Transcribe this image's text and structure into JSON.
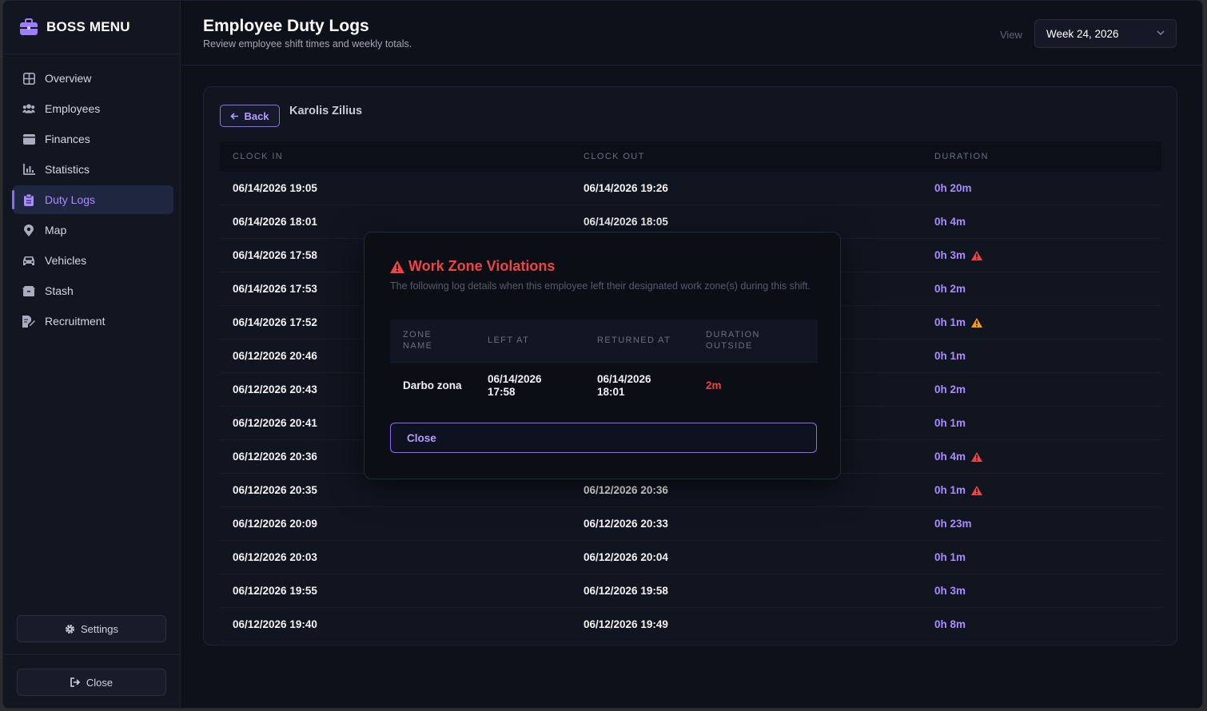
{
  "sidebar": {
    "brand": "BOSS MENU",
    "items": [
      {
        "label": "Overview",
        "icon": "grid-icon"
      },
      {
        "label": "Employees",
        "icon": "users-icon"
      },
      {
        "label": "Finances",
        "icon": "wallet-icon"
      },
      {
        "label": "Statistics",
        "icon": "chart-icon"
      },
      {
        "label": "Duty Logs",
        "icon": "clipboard-icon",
        "active": true
      },
      {
        "label": "Map",
        "icon": "map-pin-icon"
      },
      {
        "label": "Vehicles",
        "icon": "car-icon"
      },
      {
        "label": "Stash",
        "icon": "box-icon"
      },
      {
        "label": "Recruitment",
        "icon": "file-signature-icon"
      }
    ],
    "settings_label": "Settings",
    "close_label": "Close"
  },
  "header": {
    "title": "Employee Duty Logs",
    "subtitle": "Review employee shift times and weekly totals.",
    "view_label": "View",
    "week_value": "Week 24, 2026"
  },
  "card": {
    "back_label": "Back",
    "employee_name": "Karolis Zilius",
    "columns": [
      "CLOCK IN",
      "CLOCK OUT",
      "DURATION"
    ],
    "rows": [
      {
        "clock_in": "06/14/2026 19:05",
        "clock_out": "06/14/2026 19:26",
        "duration": "0h 20m",
        "warning": null
      },
      {
        "clock_in": "06/14/2026 18:01",
        "clock_out": "06/14/2026 18:05",
        "duration": "0h 4m",
        "warning": null
      },
      {
        "clock_in": "06/14/2026 17:58",
        "clock_out": "",
        "duration": "0h 3m",
        "warning": "red"
      },
      {
        "clock_in": "06/14/2026 17:53",
        "clock_out": "",
        "duration": "0h 2m",
        "warning": null
      },
      {
        "clock_in": "06/14/2026 17:52",
        "clock_out": "",
        "duration": "0h 1m",
        "warning": "orange"
      },
      {
        "clock_in": "06/12/2026 20:46",
        "clock_out": "",
        "duration": "0h 1m",
        "warning": null
      },
      {
        "clock_in": "06/12/2026 20:43",
        "clock_out": "",
        "duration": "0h 2m",
        "warning": null
      },
      {
        "clock_in": "06/12/2026 20:41",
        "clock_out": "",
        "duration": "0h 1m",
        "warning": null
      },
      {
        "clock_in": "06/12/2026 20:36",
        "clock_out": "",
        "duration": "0h 4m",
        "warning": "red"
      },
      {
        "clock_in": "06/12/2026 20:35",
        "clock_out": "06/12/2026 20:36",
        "duration": "0h 1m",
        "warning": "red"
      },
      {
        "clock_in": "06/12/2026 20:09",
        "clock_out": "06/12/2026 20:33",
        "duration": "0h 23m",
        "warning": null
      },
      {
        "clock_in": "06/12/2026 20:03",
        "clock_out": "06/12/2026 20:04",
        "duration": "0h 1m",
        "warning": null
      },
      {
        "clock_in": "06/12/2026 19:55",
        "clock_out": "06/12/2026 19:58",
        "duration": "0h 3m",
        "warning": null
      },
      {
        "clock_in": "06/12/2026 19:40",
        "clock_out": "06/12/2026 19:49",
        "duration": "0h 8m",
        "warning": null
      }
    ]
  },
  "modal": {
    "title": "Work Zone Violations",
    "description": "The following log details when this employee left their designated work zone(s) during this shift.",
    "columns": {
      "zone_line1": "ZONE",
      "zone_line2": "NAME",
      "left_at": "LEFT AT",
      "returned_at": "RETURNED AT",
      "duration_line1": "DURATION",
      "duration_line2": "OUTSIDE"
    },
    "violations": [
      {
        "zone": "Darbo zona",
        "left_date": "06/14/2026",
        "left_time": "17:58",
        "returned_date": "06/14/2026",
        "returned_time": "18:01",
        "duration": "2m"
      }
    ],
    "close_label": "Close"
  },
  "colors": {
    "accent": "#8b6cf6",
    "danger": "#ef4444",
    "warning": "#f59e0b"
  }
}
